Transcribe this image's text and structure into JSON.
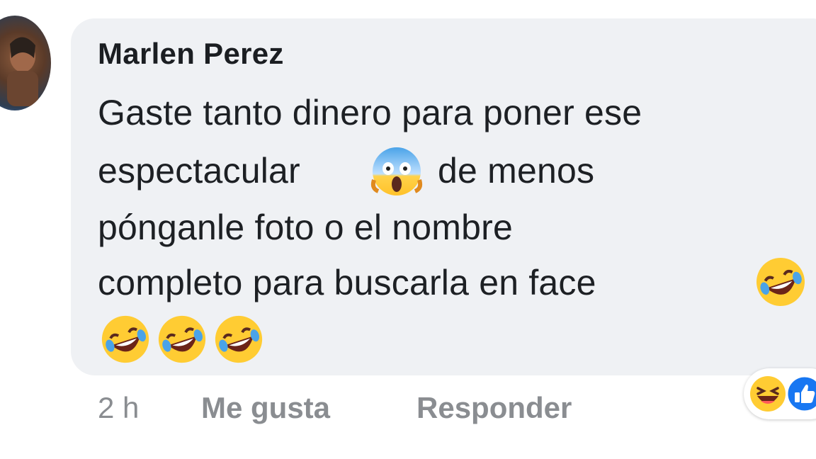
{
  "comment": {
    "author": "Marlen Perez",
    "lines": [
      "Gaste tanto dinero para poner ese",
      "espectacular",
      "de menos",
      "pónganle foto o el nombre",
      "completo para buscarla en face"
    ],
    "inline_emojis": [
      "screaming-face-emoji",
      "rolling-laughing-emoji",
      "rolling-laughing-emoji",
      "rolling-laughing-emoji",
      "rolling-laughing-emoji"
    ]
  },
  "actions": {
    "time": "2 h",
    "like": "Me gusta",
    "reply": "Responder"
  },
  "reactions": [
    "haha-reaction-icon",
    "like-reaction-icon"
  ],
  "colors": {
    "bubble": "#eff1f4",
    "text": "#1d2024",
    "muted": "#8a8d91",
    "like_blue": "#1877f2",
    "emoji_yellow": "#ffcc33"
  }
}
